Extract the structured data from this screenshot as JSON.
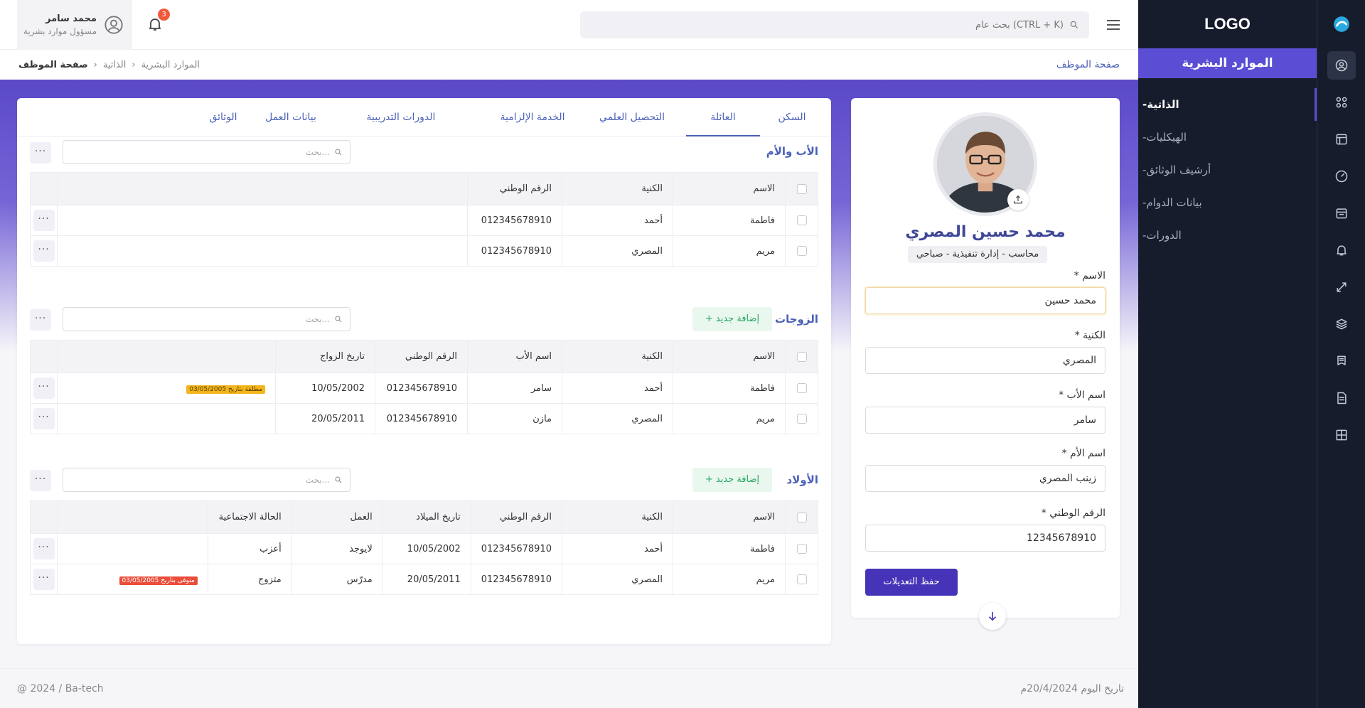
{
  "app": {
    "logo": "LOGO",
    "section_title": "الموارد البشرية"
  },
  "sidebar": {
    "items": [
      {
        "label": "الذاتية",
        "active": true
      },
      {
        "label": "الهيكليات"
      },
      {
        "label": "أرشيف الوثائق"
      },
      {
        "label": "بيانات الدوام"
      },
      {
        "label": "الدورات"
      }
    ],
    "icons": [
      "user-circle-icon",
      "grid-icon",
      "layout-icon",
      "gauge-icon",
      "calendar-icon",
      "bell-icon",
      "tools-icon",
      "layers-icon",
      "book-icon",
      "report-icon",
      "table-icon"
    ]
  },
  "header": {
    "search_placeholder": "بحث عام (CTRL + K)",
    "notifications_count": "3",
    "user_name": "محمد سامر",
    "user_role": "مسؤول موارد بشرية"
  },
  "breadcrumb": {
    "root": "الموارد البشرية",
    "mid": "الذاتية",
    "current": "صفحة الموظف",
    "page_title": "صفحة الموظف"
  },
  "profile": {
    "name": "محمد حسين المصري",
    "role": "محاسب - إدارة تنفيذية - صباحي",
    "fields": [
      {
        "label": "الاسم *",
        "value": "محمد حسين"
      },
      {
        "label": "الكنية *",
        "value": "المصري"
      },
      {
        "label": "اسم الأب *",
        "value": "سامر"
      },
      {
        "label": "اسم الأم *",
        "value": "زينب المصري"
      },
      {
        "label": "الرقم الوطني *",
        "value": "12345678910"
      }
    ],
    "save_label": "حفظ التعديلات"
  },
  "tabs": [
    {
      "label": "السكن"
    },
    {
      "label": "العائلة",
      "active": true
    },
    {
      "label": "التحصيل العلمي"
    },
    {
      "label": "الخدمة الإلزامية"
    },
    {
      "label": "الدورات التدريبية"
    },
    {
      "label": "بيانات العمل"
    },
    {
      "label": "الوثائق"
    }
  ],
  "common": {
    "search_placeholder": "بحث...",
    "add_label": "+ إضافة جديد",
    "more": "···"
  },
  "parents": {
    "title": "الأب والأم",
    "headers": [
      "الاسم",
      "الكنية",
      "الرقم الوطني"
    ],
    "rows": [
      [
        "فاطمة",
        "أحمد",
        "012345678910"
      ],
      [
        "مريم",
        "المصري",
        "012345678910"
      ]
    ]
  },
  "spouses": {
    "title": "الزوجات",
    "headers": [
      "الاسم",
      "الكنية",
      "اسم الأب",
      "الرقم الوطني",
      "تاريخ الزواج"
    ],
    "rows": [
      [
        "فاطمة",
        "أحمد",
        "سامر",
        "012345678910",
        "10/05/2002",
        "مطلقة بتاريخ 03/05/2005"
      ],
      [
        "مريم",
        "المصري",
        "مازن",
        "012345678910",
        "20/05/2011",
        ""
      ]
    ]
  },
  "children": {
    "title": "الأولاد",
    "headers": [
      "الاسم",
      "الكنية",
      "الرقم الوطني",
      "تاريخ الميلاد",
      "العمل",
      "الحالة الاجتماعية"
    ],
    "rows": [
      [
        "فاطمة",
        "أحمد",
        "012345678910",
        "10/05/2002",
        "لايوجد",
        "أعزب",
        ""
      ],
      [
        "مريم",
        "المصري",
        "012345678910",
        "20/05/2011",
        "مدرّس",
        "متزوج",
        "متوفى بتاريخ 03/05/2005"
      ]
    ]
  },
  "footer": {
    "copyright": "@ 2024 / Ba-tech",
    "date": "تاريخ اليوم 20/4/2024م"
  },
  "colors": {
    "primary": "#4534b7",
    "accent": "#5b4ed4",
    "sidebar": "#171c2c",
    "link": "#4a5fb8",
    "success": "#28a862",
    "warning": "#f3b51b",
    "danger": "#ea4d3a"
  }
}
